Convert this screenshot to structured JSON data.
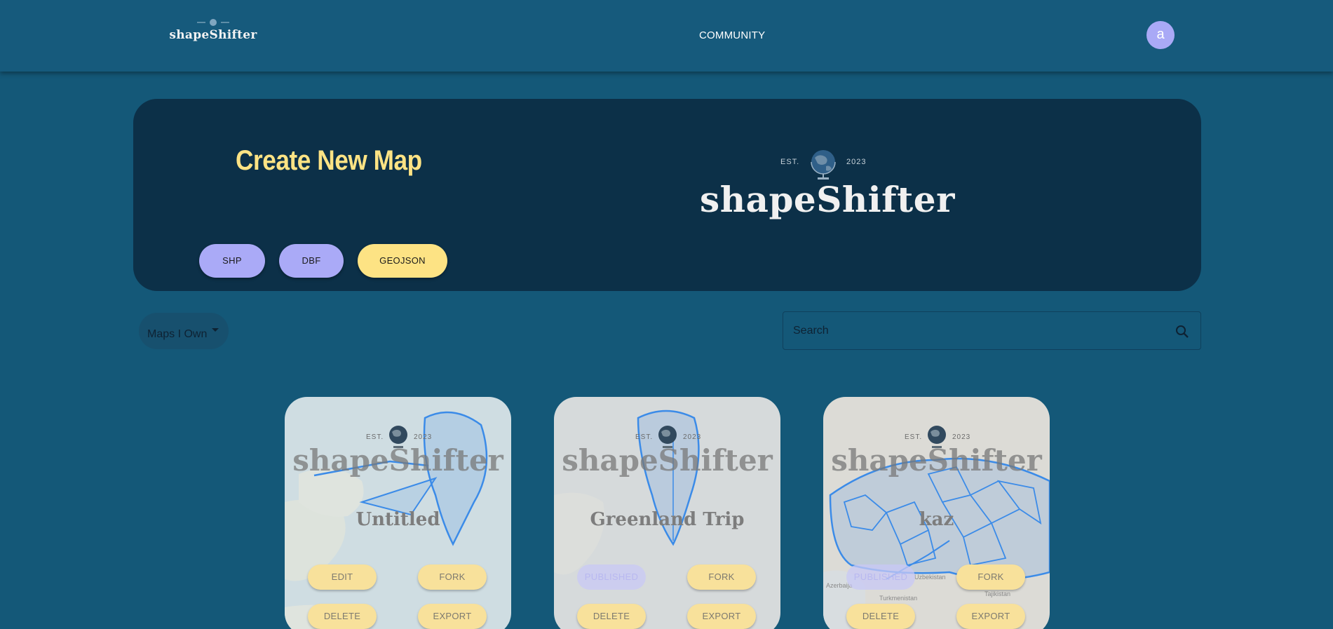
{
  "nav": {
    "logo_text": "shapeShifter",
    "community_label": "COMMUNITY",
    "avatar_letter": "a"
  },
  "banner": {
    "title": "Create New Map",
    "buttons": {
      "shp": "SHP",
      "dbf": "DBF",
      "geojson": "GEOJSON"
    },
    "logo": {
      "est": "EST.",
      "year": "2023",
      "word": "shapeShifter"
    }
  },
  "filter": {
    "selected": "Maps I Own"
  },
  "search": {
    "placeholder": "Search"
  },
  "cards": [
    {
      "title": "Untitled",
      "wm": {
        "est": "EST.",
        "year": "2023",
        "word": "shapeShifter"
      },
      "top_left": "EDIT",
      "top_right": "FORK",
      "bottom_left": "DELETE",
      "bottom_right": "EXPORT"
    },
    {
      "title": "Greenland Trip",
      "wm": {
        "est": "EST.",
        "year": "2023",
        "word": "shapeShifter"
      },
      "top_left": "PUBLISHED",
      "top_right": "FORK",
      "bottom_left": "DELETE",
      "bottom_right": "EXPORT"
    },
    {
      "title": "kaz",
      "wm": {
        "est": "EST.",
        "year": "2023",
        "word": "shapeShifter"
      },
      "top_left": "PUBLISHED",
      "top_right": "FORK",
      "bottom_left": "DELETE",
      "bottom_right": "EXPORT",
      "map_labels": [
        "Azerbaija",
        "Uzbekistan",
        "Turkmenistan",
        "Tajikistan"
      ]
    }
  ],
  "colors": {
    "page_bg": "#145878",
    "banner_bg": "#0c3048",
    "accent_yellow": "#fde384",
    "accent_purple": "#aaaaf7",
    "map_outline": "#3b8be8"
  }
}
